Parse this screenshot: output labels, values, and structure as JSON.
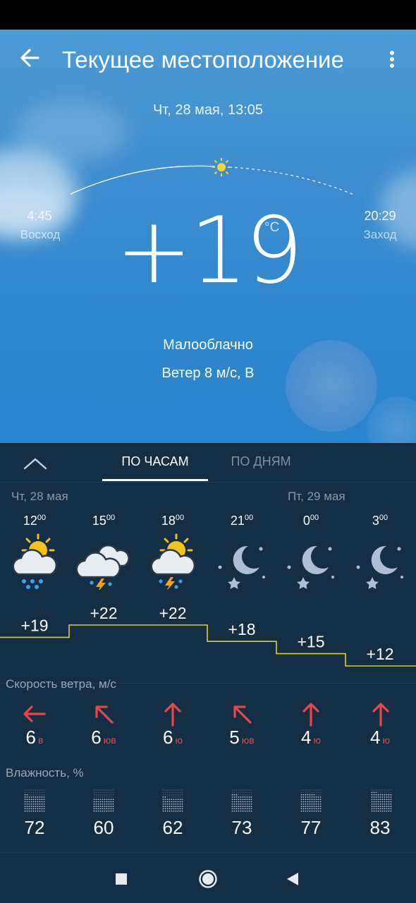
{
  "header": {
    "title": "Текущее местоположение"
  },
  "current": {
    "datetime": "Чт, 28 мая, 13:05",
    "sunrise_time": "4:45",
    "sunrise_label": "Восход",
    "sunset_time": "20:29",
    "sunset_label": "Заход",
    "temperature": "+19",
    "unit": "°C",
    "condition": "Малооблачно",
    "wind": "Ветер 8 м/с, В"
  },
  "tabs": {
    "hourly": "ПО ЧАСАМ",
    "daily": "ПО ДНЯМ",
    "active": "hourly"
  },
  "days": {
    "day1": "Чт, 28 мая",
    "day2": "Пт, 29 мая"
  },
  "forecast": [
    {
      "hour": "12",
      "minutes": "00",
      "icon": "partly-cloudy-rain-icon",
      "temp": "+19",
      "wind_speed": "6",
      "wind_dir": "в",
      "wind_arrow": "arrow-left-icon",
      "humidity": "72"
    },
    {
      "hour": "15",
      "minutes": "00",
      "icon": "cloudy-thunderstorm-icon",
      "temp": "+22",
      "wind_speed": "6",
      "wind_dir": "юв",
      "wind_arrow": "arrow-up-left-icon",
      "humidity": "60"
    },
    {
      "hour": "18",
      "minutes": "00",
      "icon": "partly-cloudy-thunderstorm-icon",
      "temp": "+22",
      "wind_speed": "6",
      "wind_dir": "ю",
      "wind_arrow": "arrow-up-icon",
      "humidity": "62"
    },
    {
      "hour": "21",
      "minutes": "00",
      "icon": "moon-stars-icon",
      "temp": "+18",
      "wind_speed": "5",
      "wind_dir": "юв",
      "wind_arrow": "arrow-up-left-icon",
      "humidity": "73"
    },
    {
      "hour": "0",
      "minutes": "00",
      "icon": "moon-stars-icon",
      "temp": "+15",
      "wind_speed": "4",
      "wind_dir": "ю",
      "wind_arrow": "arrow-up-icon",
      "humidity": "77"
    },
    {
      "hour": "3",
      "minutes": "00",
      "icon": "moon-stars-icon",
      "temp": "+12",
      "wind_speed": "4",
      "wind_dir": "ю",
      "wind_arrow": "arrow-up-icon",
      "humidity": "83"
    }
  ],
  "sections": {
    "wind": "Скорость ветра, м/с",
    "humidity": "Влажность, %"
  },
  "colors": {
    "panel": "#142e44",
    "accent_line": "#d9d02a",
    "wind_arrow": "#e8474a",
    "sky": "#3d8ed0"
  }
}
